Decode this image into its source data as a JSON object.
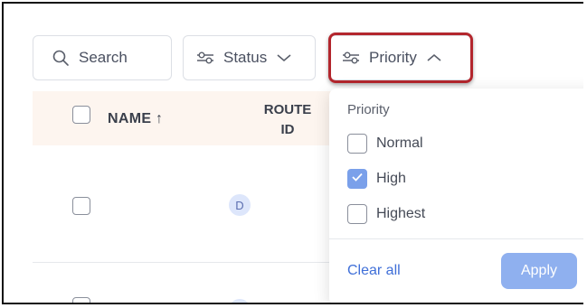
{
  "toolbar": {
    "search_label": "Search",
    "status_label": "Status",
    "priority_label": "Priority"
  },
  "table": {
    "columns": {
      "name": "NAME ↑",
      "route_line1": "ROUTE",
      "route_line2": "ID"
    },
    "rows": [
      {
        "avatar": "D"
      },
      {
        "avatar": ""
      }
    ]
  },
  "priority_dropdown": {
    "title": "Priority",
    "options": [
      {
        "label": "Normal",
        "checked": false
      },
      {
        "label": "High",
        "checked": true
      },
      {
        "label": "Highest",
        "checked": false
      }
    ],
    "clear_label": "Clear all",
    "apply_label": "Apply"
  },
  "colors": {
    "accent": "#7aa0ea",
    "highlight_border": "#b3262d",
    "header_bg": "#fdf5ef"
  },
  "icons": [
    "search-icon",
    "sliders-icon",
    "chevron-down-icon",
    "chevron-up-icon",
    "check-icon",
    "sort-arrow-icon"
  ]
}
